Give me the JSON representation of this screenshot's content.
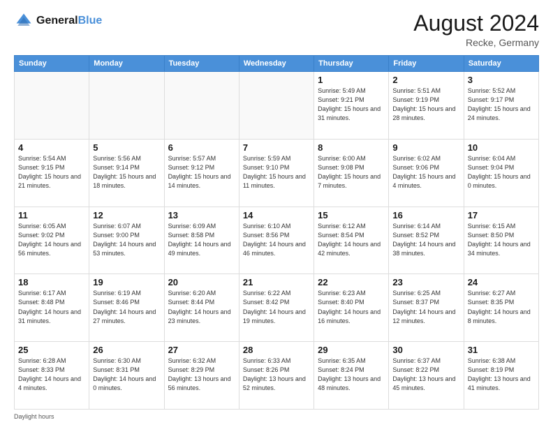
{
  "header": {
    "logo_line1": "General",
    "logo_line2": "Blue",
    "month_title": "August 2024",
    "location": "Recke, Germany"
  },
  "days_of_week": [
    "Sunday",
    "Monday",
    "Tuesday",
    "Wednesday",
    "Thursday",
    "Friday",
    "Saturday"
  ],
  "footer_text": "Daylight hours",
  "weeks": [
    [
      {
        "day": "",
        "sunrise": "",
        "sunset": "",
        "daylight": ""
      },
      {
        "day": "",
        "sunrise": "",
        "sunset": "",
        "daylight": ""
      },
      {
        "day": "",
        "sunrise": "",
        "sunset": "",
        "daylight": ""
      },
      {
        "day": "",
        "sunrise": "",
        "sunset": "",
        "daylight": ""
      },
      {
        "day": "1",
        "sunrise": "Sunrise: 5:49 AM",
        "sunset": "Sunset: 9:21 PM",
        "daylight": "Daylight: 15 hours and 31 minutes."
      },
      {
        "day": "2",
        "sunrise": "Sunrise: 5:51 AM",
        "sunset": "Sunset: 9:19 PM",
        "daylight": "Daylight: 15 hours and 28 minutes."
      },
      {
        "day": "3",
        "sunrise": "Sunrise: 5:52 AM",
        "sunset": "Sunset: 9:17 PM",
        "daylight": "Daylight: 15 hours and 24 minutes."
      }
    ],
    [
      {
        "day": "4",
        "sunrise": "Sunrise: 5:54 AM",
        "sunset": "Sunset: 9:15 PM",
        "daylight": "Daylight: 15 hours and 21 minutes."
      },
      {
        "day": "5",
        "sunrise": "Sunrise: 5:56 AM",
        "sunset": "Sunset: 9:14 PM",
        "daylight": "Daylight: 15 hours and 18 minutes."
      },
      {
        "day": "6",
        "sunrise": "Sunrise: 5:57 AM",
        "sunset": "Sunset: 9:12 PM",
        "daylight": "Daylight: 15 hours and 14 minutes."
      },
      {
        "day": "7",
        "sunrise": "Sunrise: 5:59 AM",
        "sunset": "Sunset: 9:10 PM",
        "daylight": "Daylight: 15 hours and 11 minutes."
      },
      {
        "day": "8",
        "sunrise": "Sunrise: 6:00 AM",
        "sunset": "Sunset: 9:08 PM",
        "daylight": "Daylight: 15 hours and 7 minutes."
      },
      {
        "day": "9",
        "sunrise": "Sunrise: 6:02 AM",
        "sunset": "Sunset: 9:06 PM",
        "daylight": "Daylight: 15 hours and 4 minutes."
      },
      {
        "day": "10",
        "sunrise": "Sunrise: 6:04 AM",
        "sunset": "Sunset: 9:04 PM",
        "daylight": "Daylight: 15 hours and 0 minutes."
      }
    ],
    [
      {
        "day": "11",
        "sunrise": "Sunrise: 6:05 AM",
        "sunset": "Sunset: 9:02 PM",
        "daylight": "Daylight: 14 hours and 56 minutes."
      },
      {
        "day": "12",
        "sunrise": "Sunrise: 6:07 AM",
        "sunset": "Sunset: 9:00 PM",
        "daylight": "Daylight: 14 hours and 53 minutes."
      },
      {
        "day": "13",
        "sunrise": "Sunrise: 6:09 AM",
        "sunset": "Sunset: 8:58 PM",
        "daylight": "Daylight: 14 hours and 49 minutes."
      },
      {
        "day": "14",
        "sunrise": "Sunrise: 6:10 AM",
        "sunset": "Sunset: 8:56 PM",
        "daylight": "Daylight: 14 hours and 46 minutes."
      },
      {
        "day": "15",
        "sunrise": "Sunrise: 6:12 AM",
        "sunset": "Sunset: 8:54 PM",
        "daylight": "Daylight: 14 hours and 42 minutes."
      },
      {
        "day": "16",
        "sunrise": "Sunrise: 6:14 AM",
        "sunset": "Sunset: 8:52 PM",
        "daylight": "Daylight: 14 hours and 38 minutes."
      },
      {
        "day": "17",
        "sunrise": "Sunrise: 6:15 AM",
        "sunset": "Sunset: 8:50 PM",
        "daylight": "Daylight: 14 hours and 34 minutes."
      }
    ],
    [
      {
        "day": "18",
        "sunrise": "Sunrise: 6:17 AM",
        "sunset": "Sunset: 8:48 PM",
        "daylight": "Daylight: 14 hours and 31 minutes."
      },
      {
        "day": "19",
        "sunrise": "Sunrise: 6:19 AM",
        "sunset": "Sunset: 8:46 PM",
        "daylight": "Daylight: 14 hours and 27 minutes."
      },
      {
        "day": "20",
        "sunrise": "Sunrise: 6:20 AM",
        "sunset": "Sunset: 8:44 PM",
        "daylight": "Daylight: 14 hours and 23 minutes."
      },
      {
        "day": "21",
        "sunrise": "Sunrise: 6:22 AM",
        "sunset": "Sunset: 8:42 PM",
        "daylight": "Daylight: 14 hours and 19 minutes."
      },
      {
        "day": "22",
        "sunrise": "Sunrise: 6:23 AM",
        "sunset": "Sunset: 8:40 PM",
        "daylight": "Daylight: 14 hours and 16 minutes."
      },
      {
        "day": "23",
        "sunrise": "Sunrise: 6:25 AM",
        "sunset": "Sunset: 8:37 PM",
        "daylight": "Daylight: 14 hours and 12 minutes."
      },
      {
        "day": "24",
        "sunrise": "Sunrise: 6:27 AM",
        "sunset": "Sunset: 8:35 PM",
        "daylight": "Daylight: 14 hours and 8 minutes."
      }
    ],
    [
      {
        "day": "25",
        "sunrise": "Sunrise: 6:28 AM",
        "sunset": "Sunset: 8:33 PM",
        "daylight": "Daylight: 14 hours and 4 minutes."
      },
      {
        "day": "26",
        "sunrise": "Sunrise: 6:30 AM",
        "sunset": "Sunset: 8:31 PM",
        "daylight": "Daylight: 14 hours and 0 minutes."
      },
      {
        "day": "27",
        "sunrise": "Sunrise: 6:32 AM",
        "sunset": "Sunset: 8:29 PM",
        "daylight": "Daylight: 13 hours and 56 minutes."
      },
      {
        "day": "28",
        "sunrise": "Sunrise: 6:33 AM",
        "sunset": "Sunset: 8:26 PM",
        "daylight": "Daylight: 13 hours and 52 minutes."
      },
      {
        "day": "29",
        "sunrise": "Sunrise: 6:35 AM",
        "sunset": "Sunset: 8:24 PM",
        "daylight": "Daylight: 13 hours and 48 minutes."
      },
      {
        "day": "30",
        "sunrise": "Sunrise: 6:37 AM",
        "sunset": "Sunset: 8:22 PM",
        "daylight": "Daylight: 13 hours and 45 minutes."
      },
      {
        "day": "31",
        "sunrise": "Sunrise: 6:38 AM",
        "sunset": "Sunset: 8:19 PM",
        "daylight": "Daylight: 13 hours and 41 minutes."
      }
    ]
  ]
}
